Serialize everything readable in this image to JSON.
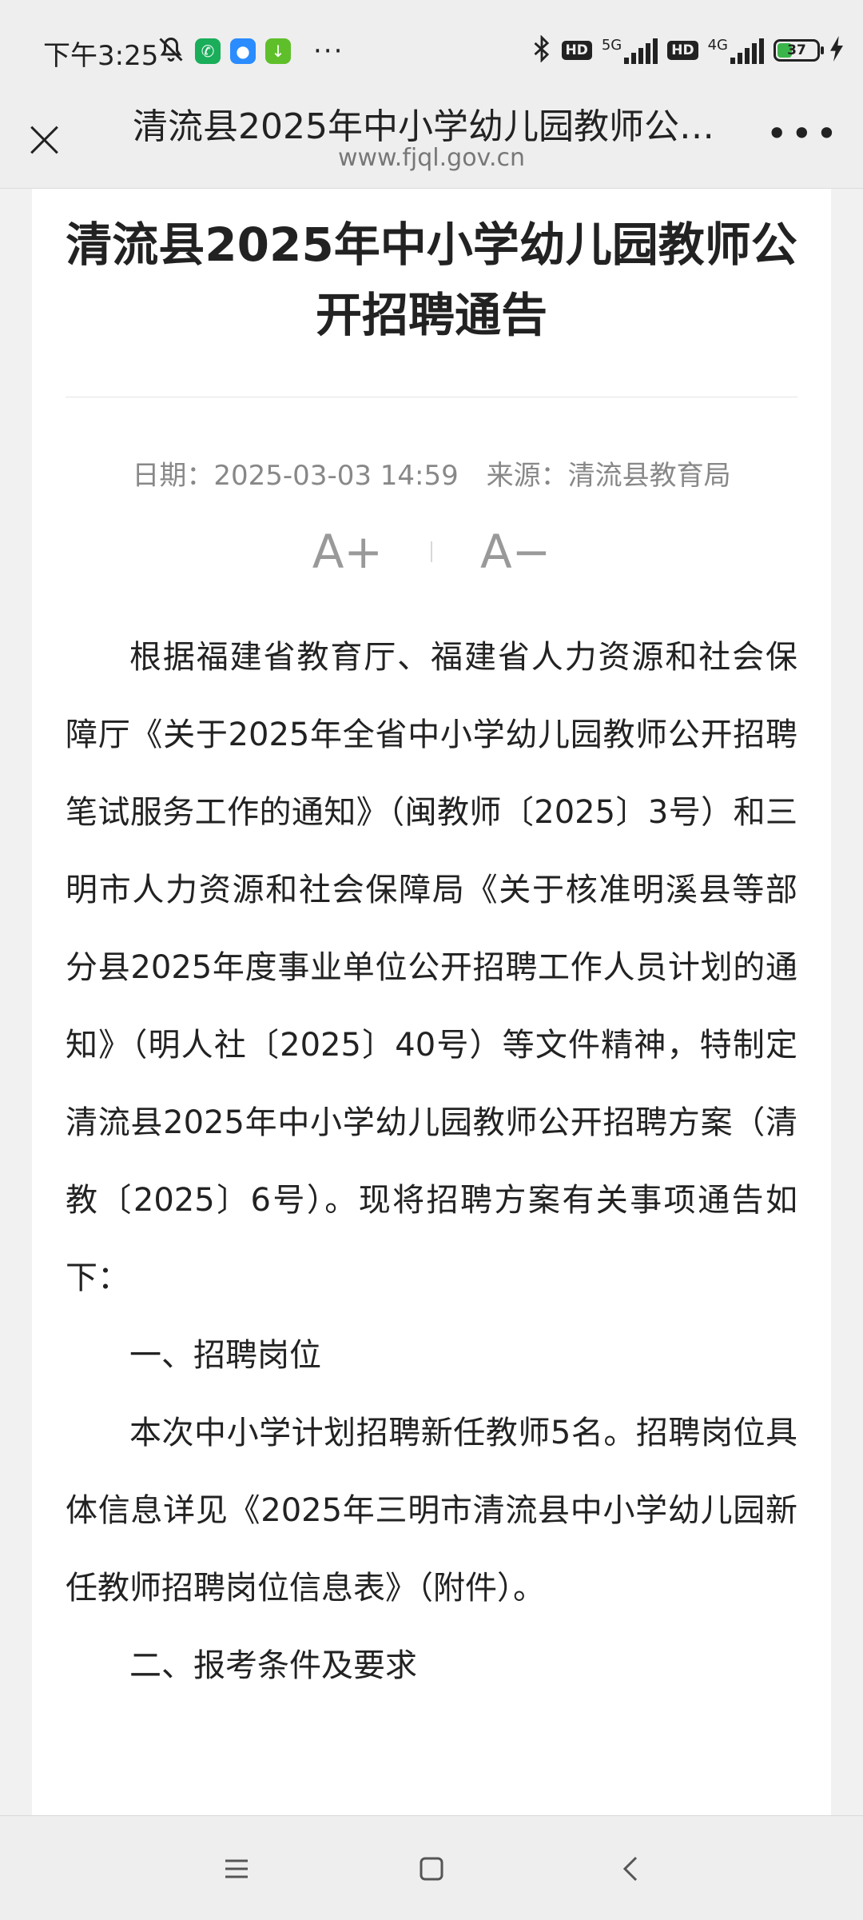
{
  "status_bar": {
    "time": "下午3:25",
    "battery": "37",
    "net1": "5G",
    "net2": "4G",
    "hd": "HD"
  },
  "titlebar": {
    "title": "清流县2025年中小学幼儿园教师公…",
    "url": "www.fjql.gov.cn"
  },
  "article": {
    "title": "清流县2025年中小学幼儿园教师公开招聘通告",
    "date": "日期：2025-03-03 14:59",
    "source": "来源：清流县教育局",
    "font_increase": "A+",
    "font_decrease": "A−",
    "paragraphs": [
      "根据福建省教育厅、福建省人力资源和社会保障厅《关于2025年全省中小学幼儿园教师公开招聘笔试服务工作的通知》（闽教师〔2025〕3号）和三明市人力资源和社会保障局《关于核准明溪县等部分县2025年度事业单位公开招聘工作人员计划的通知》（明人社〔2025〕40号）等文件精神，特制定清流县2025年中小学幼儿园教师公开招聘方案（清教〔2025〕6号）。现将招聘方案有关事项通告如下：",
      "一、招聘岗位",
      "本次中小学计划招聘新任教师5名。招聘岗位具体信息详见《2025年三明市清流县中小学幼儿园新任教师招聘岗位信息表》（附件）。",
      "二、报考条件及要求"
    ]
  },
  "colors": {
    "battery_fill": "#3ab54a",
    "wechat_green": "#1aad5a",
    "blue_app": "#2a8cff",
    "download_green": "#5fbf2a"
  }
}
